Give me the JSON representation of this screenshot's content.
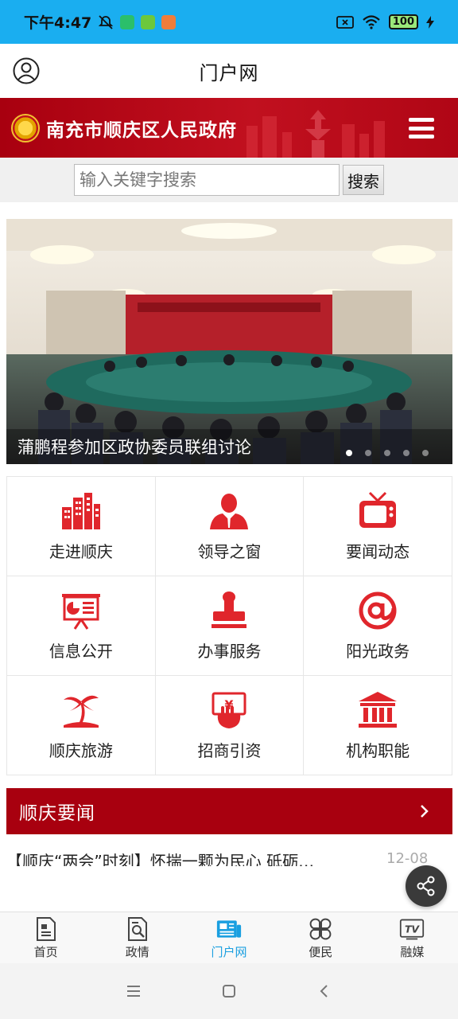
{
  "status_bar": {
    "time": "下午4:47",
    "battery": "100"
  },
  "header": {
    "title": "门户网"
  },
  "banner": {
    "gov_name": "南充市顺庆区人民政府"
  },
  "search": {
    "placeholder": "输入关键字搜索",
    "button_label": "搜索"
  },
  "carousel": {
    "caption": "蒲鹏程参加区政协委员联组讨论",
    "slide_count": 5,
    "active_index": 0
  },
  "grid": {
    "items": [
      {
        "label": "走进顺庆",
        "icon": "buildings-icon"
      },
      {
        "label": "领导之窗",
        "icon": "leader-icon"
      },
      {
        "label": "要闻动态",
        "icon": "tv-icon"
      },
      {
        "label": "信息公开",
        "icon": "presentation-board-icon"
      },
      {
        "label": "办事服务",
        "icon": "stamp-icon"
      },
      {
        "label": "阳光政务",
        "icon": "at-sign-icon"
      },
      {
        "label": "顺庆旅游",
        "icon": "palm-tree-icon"
      },
      {
        "label": "招商引资",
        "icon": "yuan-investment-icon"
      },
      {
        "label": "机构职能",
        "icon": "institution-icon"
      }
    ]
  },
  "news": {
    "section_title": "顺庆要闻",
    "items": [
      {
        "title": "【顺庆“两会”时刻】怀揣一颗为民心 砥砺…",
        "date": "12-08"
      }
    ]
  },
  "bottom_nav": {
    "items": [
      {
        "label": "首页",
        "icon": "document-icon"
      },
      {
        "label": "政情",
        "icon": "search-document-icon"
      },
      {
        "label": "门户网",
        "icon": "newspaper-icon",
        "active": true
      },
      {
        "label": "便民",
        "icon": "clover-grid-icon"
      },
      {
        "label": "融媒",
        "icon": "tv-icon"
      }
    ]
  },
  "colors": {
    "status_bar": "#1aaef0",
    "brand_red": "#a8000f",
    "icon_red": "#e0262c",
    "active_blue": "#1a9fe0"
  }
}
